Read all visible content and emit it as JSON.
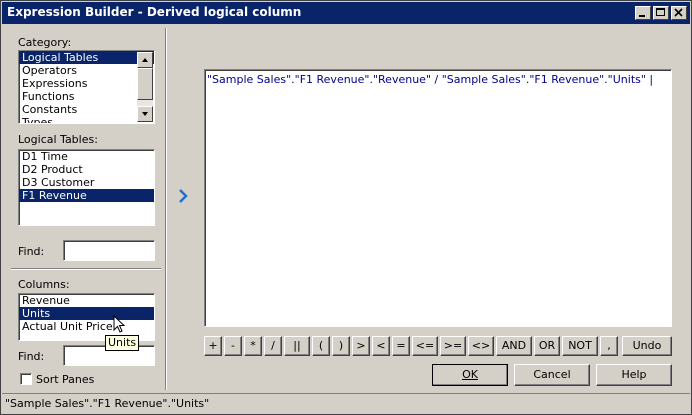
{
  "window": {
    "title": "Expression Builder - Derived logical column"
  },
  "category": {
    "label": "Category:",
    "items": [
      "Logical Tables",
      "Operators",
      "Expressions",
      "Functions",
      "Constants",
      "Types"
    ],
    "selected": "Logical Tables"
  },
  "logical_tables": {
    "label": "Logical Tables:",
    "items": [
      "D1 Time",
      "D2 Product",
      "D3 Customer",
      "F1 Revenue"
    ],
    "selected": "F1 Revenue"
  },
  "find_top": {
    "label": "Find:",
    "value": ""
  },
  "columns": {
    "label": "Columns:",
    "items": [
      "Revenue",
      "Units",
      "Actual Unit Price"
    ],
    "selected": "Units"
  },
  "find_bottom": {
    "label": "Find:",
    "value": ""
  },
  "sort_panes": {
    "label": "Sort Panes",
    "checked": false
  },
  "tooltip": {
    "text": "Units"
  },
  "editor": {
    "expression": "\"Sample Sales\".\"F1 Revenue\".\"Revenue\" / \"Sample Sales\".\"F1 Revenue\".\"Units\""
  },
  "operators": [
    "+",
    "-",
    "*",
    "/",
    "||",
    "(",
    ")",
    ">",
    "<",
    "=",
    "<=",
    ">=",
    "<>",
    "AND",
    "OR",
    "NOT",
    ","
  ],
  "buttons": {
    "undo": "Undo",
    "ok": "OK",
    "cancel": "Cancel",
    "help": "Help"
  },
  "status": {
    "text": "\"Sample Sales\".\"F1 Revenue\".\"Units\""
  },
  "colors": {
    "selection": "#0a246a",
    "titlebar": "#0a246a",
    "face": "#d4d0c8",
    "expression_text": "#00008b",
    "insert_arrow": "#1e6fd8"
  },
  "icons": {
    "insert": "chevron-right-icon",
    "minimize": "minimize-icon",
    "maximize": "maximize-icon",
    "close": "close-icon",
    "pointer": "mouse-pointer-icon"
  }
}
